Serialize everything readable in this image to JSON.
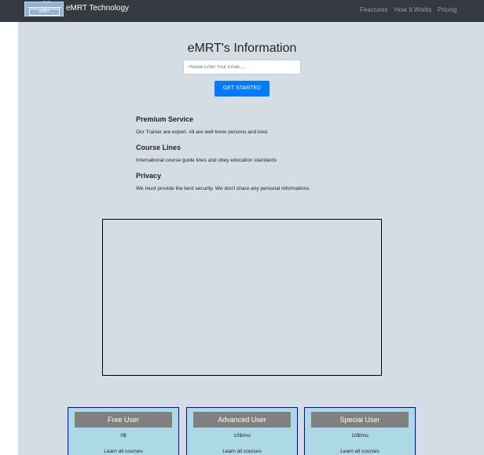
{
  "navbar": {
    "logo_text": "eMRT",
    "brand": "eMRT Technology",
    "links": [
      "Feactures",
      "How It Works",
      "Pricing"
    ]
  },
  "hero": {
    "title": "eMRT's Information",
    "email_placeholder": "Please Enter Your Email.....",
    "button_label": "GET STARTED"
  },
  "features": [
    {
      "heading": "Premium Service",
      "text": "Our Trainer are expert. All are well know persons and kind."
    },
    {
      "heading": "Course Lines",
      "text": "International course guide lines and obey education standards"
    },
    {
      "heading": "Privacy",
      "text": "We must provide the best security. We don't share any personal informations."
    }
  ],
  "pricing": [
    {
      "name": "Free User",
      "price": "0$",
      "desc": "Learn all courses"
    },
    {
      "name": "Advanced User",
      "price": "10$/mo",
      "desc": "Learn all courses"
    },
    {
      "name": "Special User",
      "price": "10$/mo",
      "desc": "Learn all courses"
    }
  ],
  "colors": {
    "navbar_bg": "#343a40",
    "main_bg": "#d4dde4",
    "button_bg": "#007bff",
    "card_bg": "#add8e6",
    "card_header_bg": "#808080",
    "card_border": "#0000ee"
  }
}
